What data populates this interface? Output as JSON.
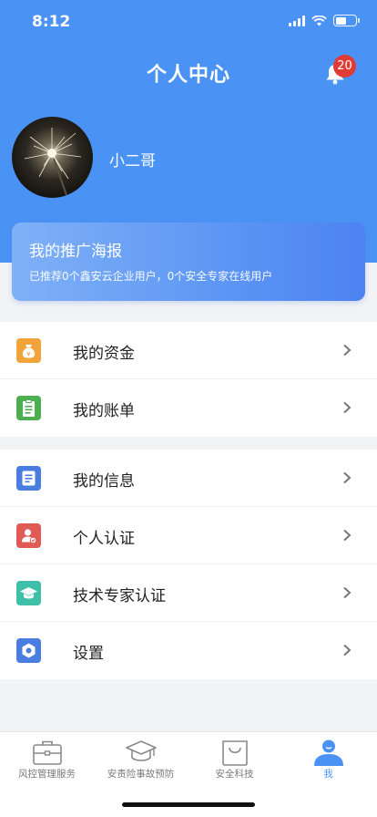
{
  "status_bar": {
    "time": "8:12"
  },
  "header": {
    "title": "个人中心",
    "notification_count": "20"
  },
  "profile": {
    "username": "小二哥"
  },
  "promo": {
    "title": "我的推广海报",
    "description": "已推荐0个鑫安云企业用户，0个安全专家在线用户"
  },
  "menu": {
    "group1": [
      {
        "label": "我的资金",
        "icon": "money-bag-icon",
        "color": "#f0a43a"
      },
      {
        "label": "我的账单",
        "icon": "bill-icon",
        "color": "#4caf50"
      }
    ],
    "group2": [
      {
        "label": "我的信息",
        "icon": "document-icon",
        "color": "#4a7de0"
      },
      {
        "label": "个人认证",
        "icon": "user-verify-icon",
        "color": "#e05a56"
      },
      {
        "label": "技术专家认证",
        "icon": "graduation-cap-icon",
        "color": "#3dbfa8"
      },
      {
        "label": "设置",
        "icon": "settings-icon",
        "color": "#4a7de0"
      }
    ]
  },
  "tabbar": {
    "items": [
      {
        "label": "风控管理服务",
        "icon": "briefcase-icon"
      },
      {
        "label": "安责险事故预防",
        "icon": "graduation-cap-icon"
      },
      {
        "label": "安全科技",
        "icon": "shopping-bag-icon"
      },
      {
        "label": "我",
        "icon": "person-icon",
        "active": true
      }
    ]
  },
  "colors": {
    "primary": "#4a93f4",
    "badge": "#e03b35"
  }
}
